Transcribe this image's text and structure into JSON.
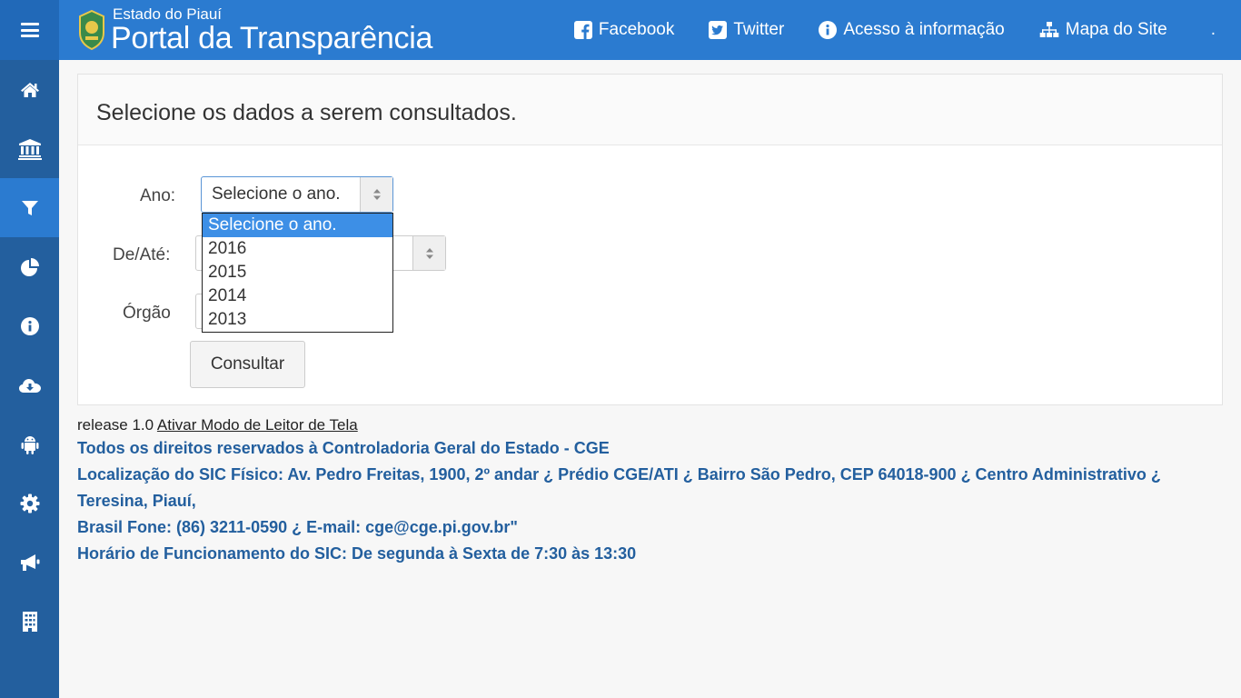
{
  "header": {
    "brand_small": "Estado do Piauí",
    "brand_big": "Portal da Transparência",
    "nav": [
      "Facebook",
      "Twitter",
      "Acesso à informação",
      "Mapa do Site"
    ],
    "trailing": "."
  },
  "colors": {
    "topbar": "#2b7bd0",
    "sidebar": "#235f9e",
    "accent": "#3d8fe6",
    "footer_text": "#235f9e"
  },
  "sidebar": {
    "icons": [
      "home-icon",
      "institution-icon",
      "filter-icon",
      "pie-chart-icon",
      "info-icon",
      "cloud-download-icon",
      "android-icon",
      "gear-icon",
      "megaphone-icon",
      "building-icon"
    ],
    "active_index": 2
  },
  "panel": {
    "title": "Selecione os dados a serem consultados.",
    "ano_label": "Ano:",
    "ano_value": "Selecione o ano.",
    "ano_options": [
      "Selecione o ano.",
      "2016",
      "2015",
      "2014",
      "2013"
    ],
    "periodo_label": "De/Até:",
    "orgao_label": "Órgão",
    "button": "Consultar"
  },
  "footer": {
    "release": "release 1.0",
    "reader_link": "Ativar Modo de Leitor de Tela",
    "lines": [
      "Todos os direitos reservados à Controladoria Geral do Estado - CGE",
      "Localização do SIC Físico: Av. Pedro Freitas, 1900, 2º andar ¿ Prédio CGE/ATI ¿ Bairro São Pedro, CEP 64018-900 ¿ Centro Administrativo ¿ Teresina, Piauí,",
      "Brasil Fone: (86) 3211-0590 ¿ E-mail: cge@cge.pi.gov.br\"",
      "Horário de Funcionamento do SIC: De segunda à Sexta de 7:30 às 13:30"
    ]
  }
}
